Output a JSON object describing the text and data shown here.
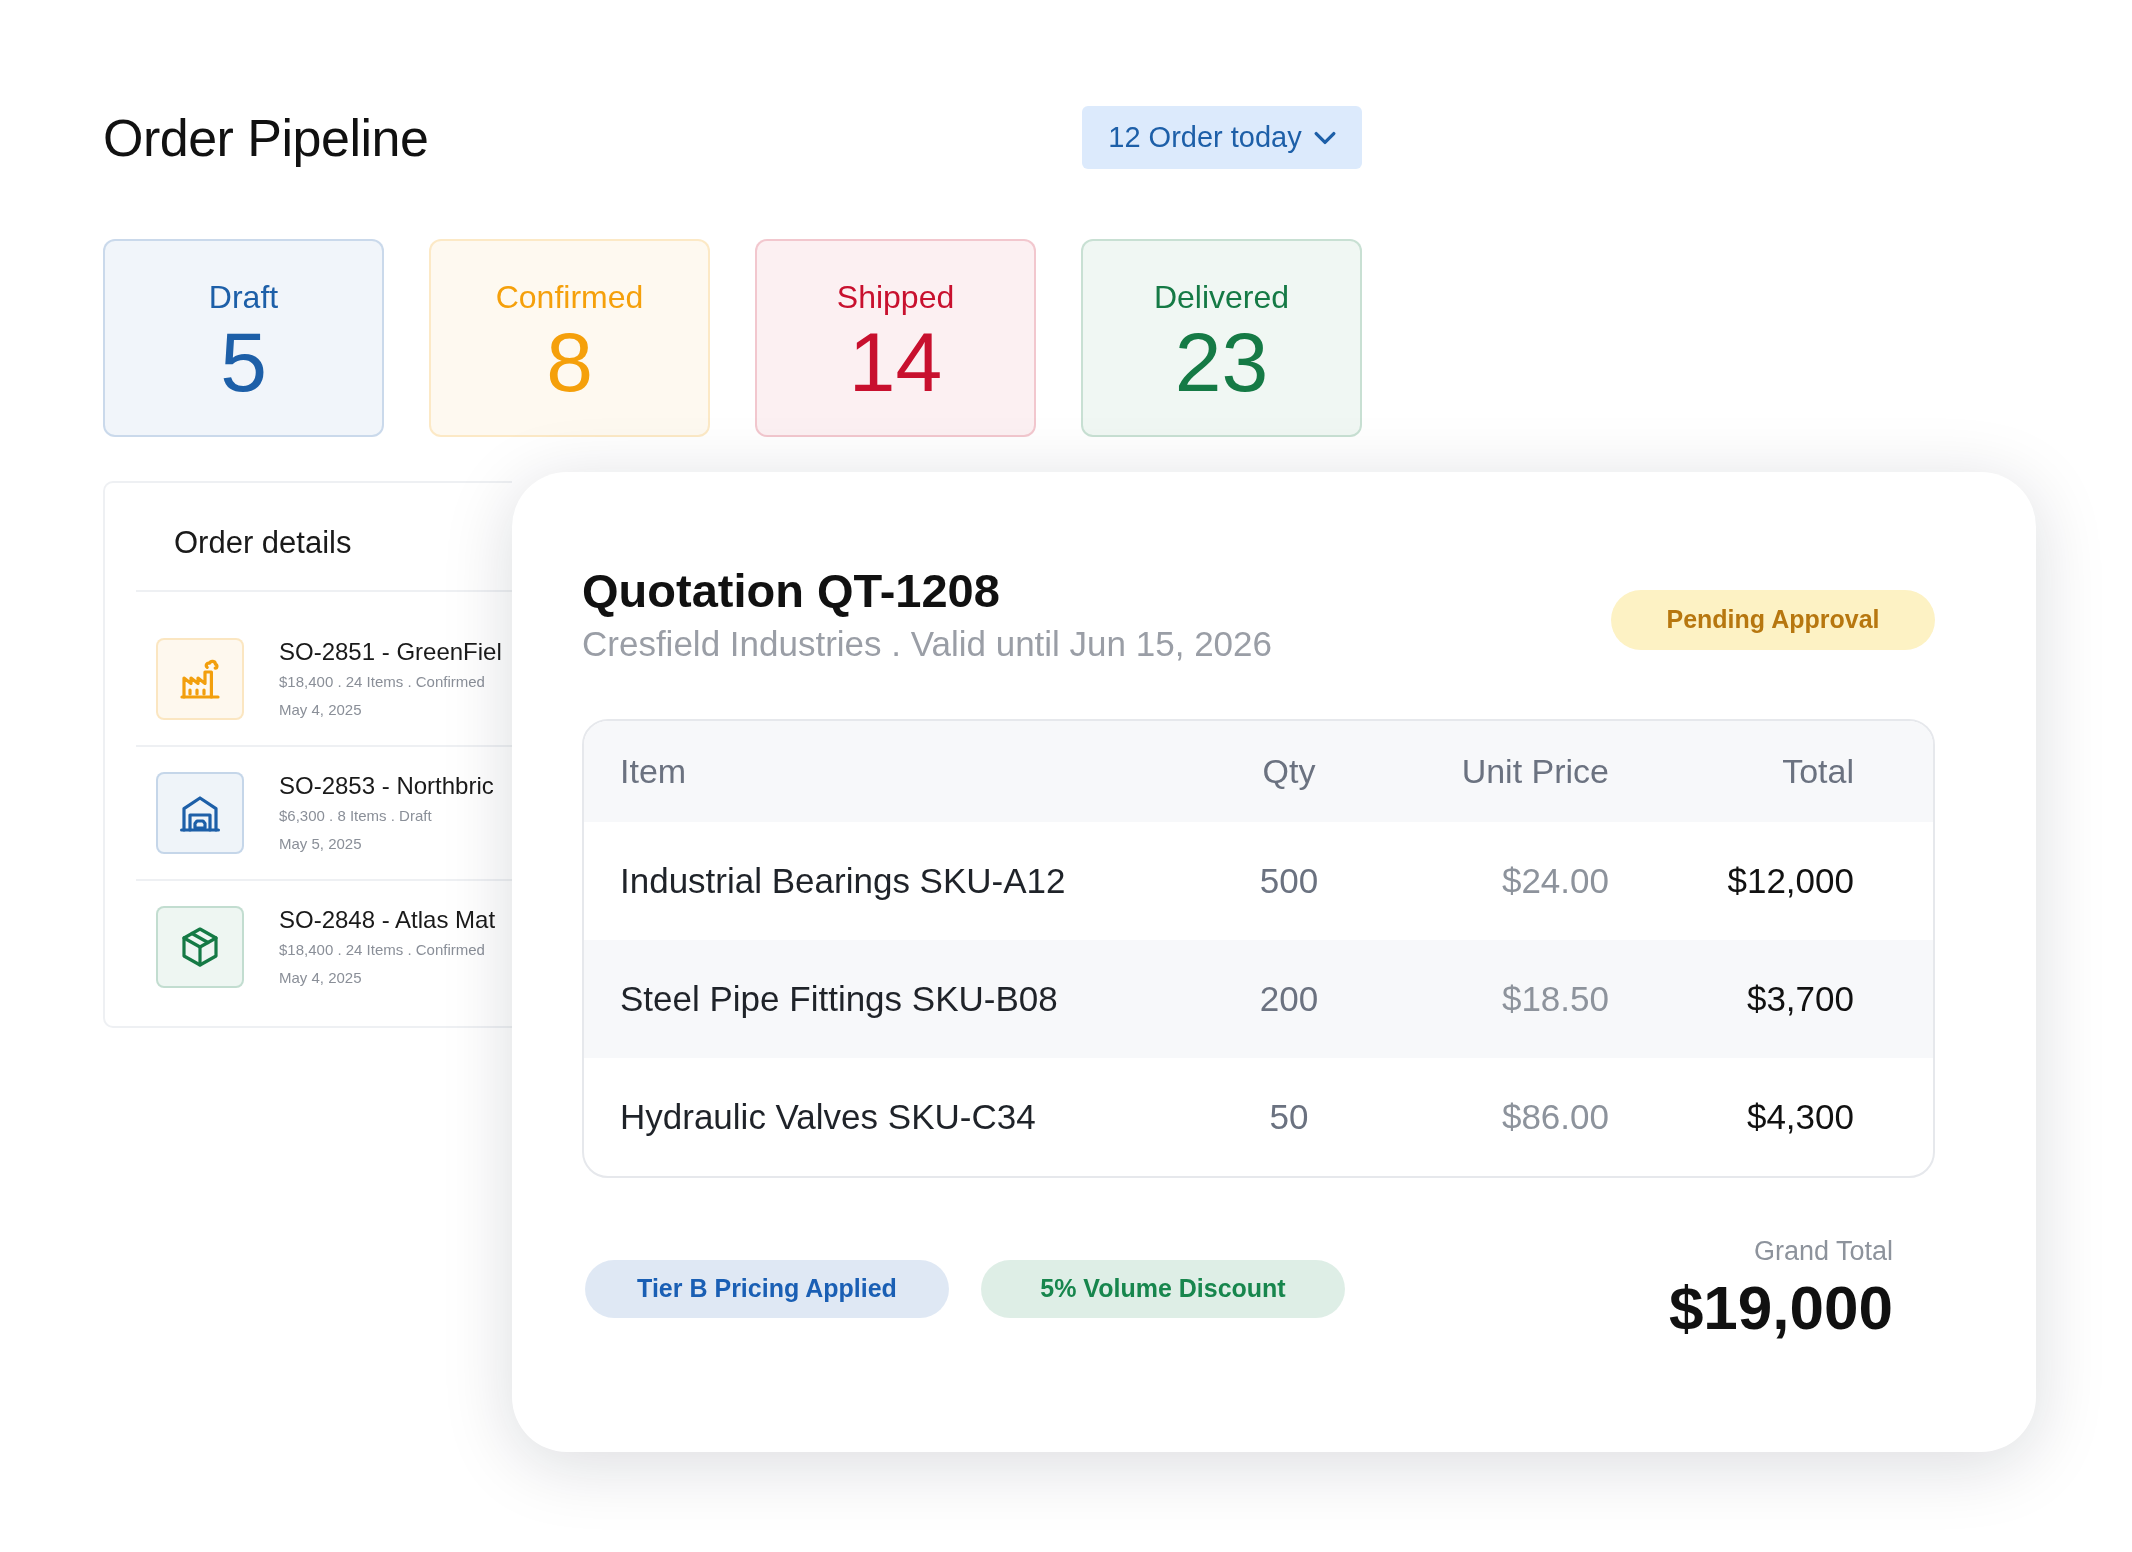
{
  "header": {
    "title": "Order Pipeline",
    "orders_today": "12 Order today"
  },
  "status_cards": [
    {
      "label": "Draft",
      "count": "5",
      "color": "#1d5fa8"
    },
    {
      "label": "Confirmed",
      "count": "8",
      "color": "#f5a00b"
    },
    {
      "label": "Shipped",
      "count": "14",
      "color": "#c8102e"
    },
    {
      "label": "Delivered",
      "count": "23",
      "color": "#157a45"
    }
  ],
  "order_details": {
    "title": "Order details",
    "orders": [
      {
        "kind": "factory",
        "color": "#f29f0d",
        "title": "SO-2851 - GreenFiel",
        "summary": "$18,400 . 24 Items . Confirmed",
        "date": "May 4, 2025"
      },
      {
        "kind": "warehouse",
        "color": "#1d5fa8",
        "title": "SO-2853 - Northbric",
        "summary": "$6,300 . 8 Items . Draft",
        "date": "May 5, 2025"
      },
      {
        "kind": "package",
        "color": "#157a45",
        "title": "SO-2848 - Atlas Mat",
        "summary": "$18,400 . 24 Items . Confirmed",
        "date": "May 4, 2025"
      }
    ]
  },
  "quotation": {
    "title": "Quotation QT-1208",
    "subtitle": "Cresfield Industries . Valid until Jun 15, 2026",
    "status": "Pending Approval",
    "table": {
      "columns": [
        "Item",
        "Qty",
        "Unit Price",
        "Total"
      ],
      "rows": [
        [
          "Industrial Bearings SKU-A12",
          "500",
          "$24.00",
          "$12,000"
        ],
        [
          "Steel Pipe Fittings SKU-B08",
          "200",
          "$18.50",
          "$3,700"
        ],
        [
          "Hydraulic Valves SKU-C34",
          "50",
          "$86.00",
          "$4,300"
        ]
      ]
    },
    "tags": [
      {
        "label": "Tier B Pricing Applied",
        "color": "#1a5fb4"
      },
      {
        "label": "5% Volume Discount",
        "color": "#17864d"
      }
    ],
    "grand_total": {
      "label": "Grand Total",
      "value": "$19,000"
    }
  }
}
